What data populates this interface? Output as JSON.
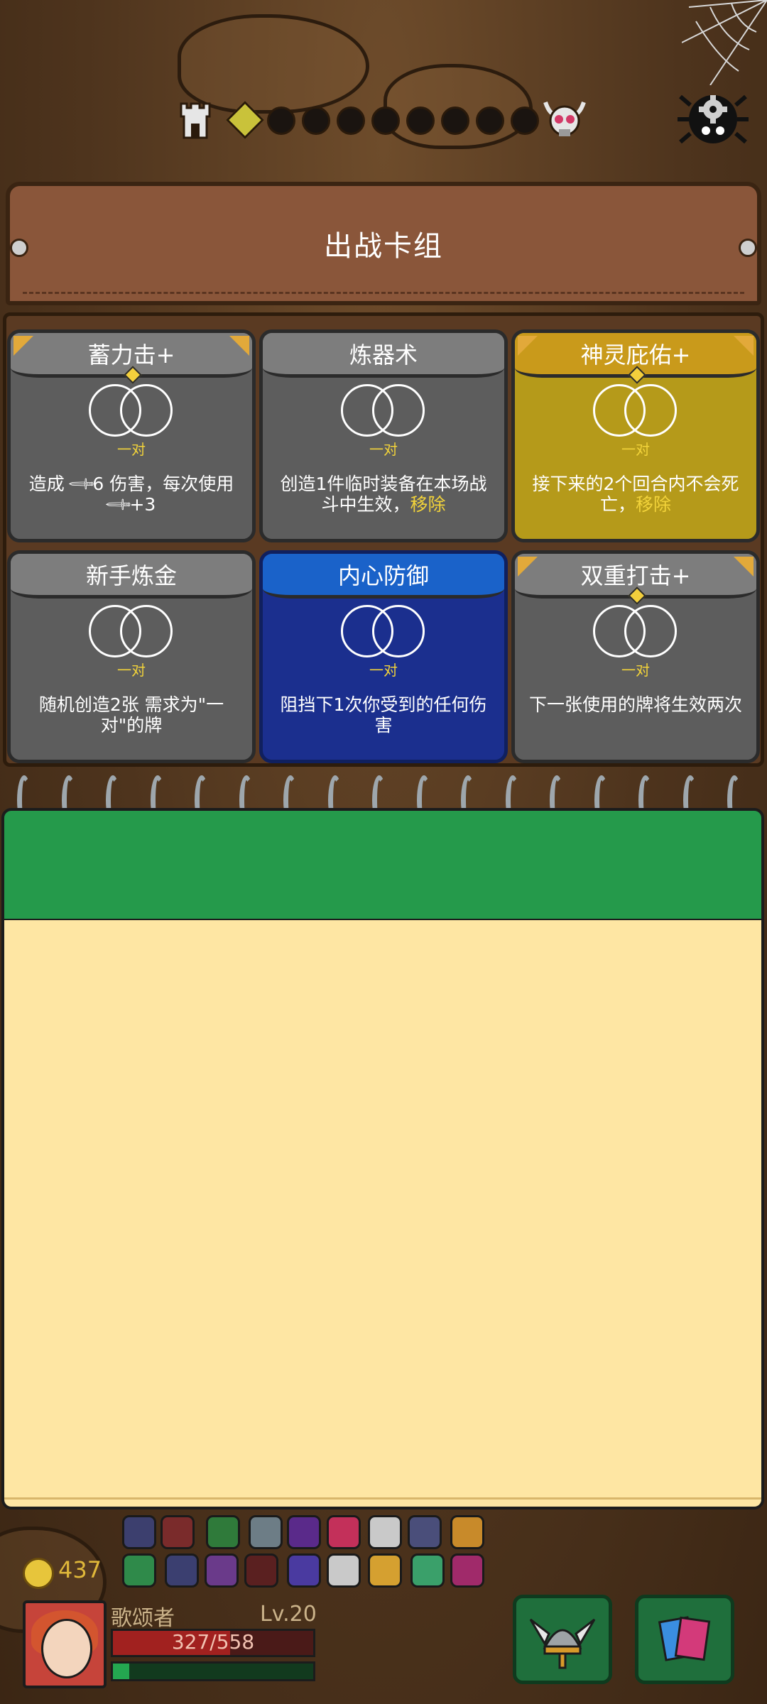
{
  "map": {
    "start_icon": "tower-icon",
    "boss_icon": "horned-skull-icon",
    "settings_icon": "gear-spider-icon",
    "current_node_color": "#c9c23a",
    "node_count": 8
  },
  "deck": {
    "title": "出战卡组",
    "cards": [
      {
        "name": "蓄力击+",
        "tier": "upgraded",
        "requirement": "一对",
        "desc_pre": "造成 ",
        "desc_mid": "6 伤害，每次使用",
        "desc_post": "+3",
        "icon": "sword-icon"
      },
      {
        "name": "炼器术",
        "tier": "basic",
        "requirement": "一对",
        "desc": "创造1件临时装备在本场战斗中生效，",
        "keyword": "移除"
      },
      {
        "name": "神灵庇佑+",
        "tier": "gold",
        "requirement": "一对",
        "desc": "接下来的2个回合内不会死亡，",
        "keyword": "移除"
      },
      {
        "name": "新手炼金",
        "tier": "basic",
        "requirement": "一对",
        "desc": "随机创造2张 需求为\"一对\"的牌"
      },
      {
        "name": "内心防御",
        "tier": "blue",
        "requirement": "一对",
        "desc": "阻挡下1次你受到的任何伤害"
      },
      {
        "name": "双重打击+",
        "tier": "upgraded",
        "requirement": "一对",
        "desc": "下一张使用的牌将生效两次"
      }
    ]
  },
  "hud": {
    "gold": "437",
    "hero_name": "歌颂者",
    "level": "Lv.20",
    "hp_text": "327/558",
    "hp_fraction": 0.586,
    "xp_fraction": 0.08,
    "equipment_button_icon": "winged-helmet-icon",
    "deck_button_icon": "cards-icon"
  },
  "colors": {
    "accent_yellow": "#f2d33a",
    "card_gray": "#5d5d5d",
    "card_gold": "#b59a1a",
    "card_blue": "#1b2f8e",
    "notepad_green": "#259a4b",
    "notepad_paper": "#fee6a3"
  }
}
